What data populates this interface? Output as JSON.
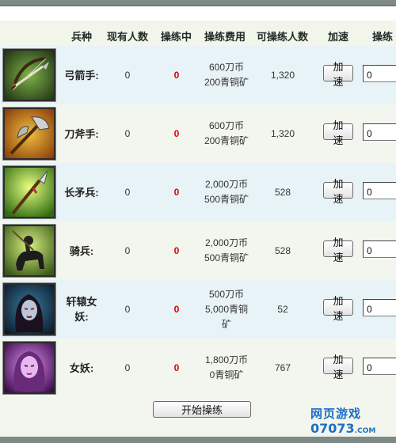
{
  "header": {
    "unit": "兵种",
    "current": "现有人数",
    "training": "操练中",
    "cost": "操练费用",
    "available": "可操练人数",
    "speedup": "加速",
    "train": "操练"
  },
  "units": [
    {
      "name": "弓箭手:",
      "have": "0",
      "training": "0",
      "cost1": "600刀币",
      "cost2": "200青铜矿",
      "cost3": "",
      "available": "1,320",
      "speedup": "加速",
      "qty": "0",
      "icon": "bow-icon"
    },
    {
      "name": "刀斧手:",
      "have": "0",
      "training": "0",
      "cost1": "600刀币",
      "cost2": "200青铜矿",
      "cost3": "",
      "available": "1,320",
      "speedup": "加速",
      "qty": "0",
      "icon": "axe-icon"
    },
    {
      "name": "长矛兵:",
      "have": "0",
      "training": "0",
      "cost1": "2,000刀币",
      "cost2": "500青铜矿",
      "cost3": "",
      "available": "528",
      "speedup": "加速",
      "qty": "0",
      "icon": "spear-icon"
    },
    {
      "name": "骑兵:",
      "have": "0",
      "training": "0",
      "cost1": "2,000刀币",
      "cost2": "500青铜矿",
      "cost3": "",
      "available": "528",
      "speedup": "加速",
      "qty": "0",
      "icon": "cavalry-icon"
    },
    {
      "name1": "轩辕女",
      "name2": "妖:",
      "have": "0",
      "training": "0",
      "cost1": "500刀币",
      "cost2": "5,000青铜",
      "cost3": "矿",
      "available": "52",
      "speedup": "加速",
      "qty": "0",
      "icon": "demon-woman-icon"
    },
    {
      "name": "女妖:",
      "have": "0",
      "training": "0",
      "cost1": "1,800刀币",
      "cost2": "0青铜矿",
      "cost3": "",
      "available": "767",
      "speedup": "加速",
      "qty": "0",
      "icon": "banshee-icon"
    }
  ],
  "footer": {
    "start_label": "开始操练"
  },
  "watermark": {
    "line1": "网页游戏",
    "line2": "07073",
    "line2_suffix": ".COM"
  },
  "colors": {
    "training_value": "#e00000",
    "row_odd": "#e8f3f7",
    "row_even": "#f3f6ee",
    "logo": "#1d6fc4"
  }
}
